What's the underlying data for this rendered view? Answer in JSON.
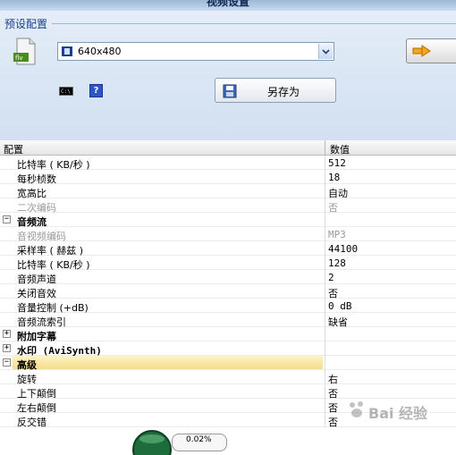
{
  "window": {
    "title": "视频设置"
  },
  "preset": {
    "section_label": "预设配置",
    "selected": "640x480",
    "save_as_label": "另存为",
    "help_glyph": "?",
    "cmd_glyph": "C:\\"
  },
  "grid": {
    "headers": {
      "name": "配置",
      "value": "数值"
    },
    "rows": [
      {
        "kind": "item",
        "name": "比特率 ( KB/秒 )",
        "value": "512"
      },
      {
        "kind": "item",
        "name": "每秒桢数",
        "value": "18"
      },
      {
        "kind": "item",
        "name": "宽高比",
        "value": "自动"
      },
      {
        "kind": "item",
        "name": "二次编码",
        "value": "否",
        "disabled": true
      },
      {
        "kind": "category",
        "name": "音频流",
        "toggle": "−"
      },
      {
        "kind": "item",
        "name": "音视频编码",
        "value": "MP3",
        "disabled": true
      },
      {
        "kind": "item",
        "name": "采样率 ( 赫兹 )",
        "value": "44100"
      },
      {
        "kind": "item",
        "name": "比特率 ( KB/秒 )",
        "value": "128"
      },
      {
        "kind": "item",
        "name": "音频声道",
        "value": "2"
      },
      {
        "kind": "item",
        "name": "关闭音效",
        "value": "否"
      },
      {
        "kind": "item",
        "name": "音量控制 (+dB)",
        "value": "0 dB"
      },
      {
        "kind": "item",
        "name": "音频流索引",
        "value": "缺省"
      },
      {
        "kind": "category",
        "name": "附加字幕",
        "toggle": "+"
      },
      {
        "kind": "category",
        "name": "水印 (AviSynth)",
        "toggle": "+"
      },
      {
        "kind": "category",
        "name": "高级",
        "toggle": "−",
        "selected": true
      },
      {
        "kind": "item",
        "name": "旋转",
        "value": "右"
      },
      {
        "kind": "item",
        "name": "上下颠倒",
        "value": "否"
      },
      {
        "kind": "item",
        "name": "左右颠倒",
        "value": "否"
      },
      {
        "kind": "item",
        "name": "反交错",
        "value": "否"
      }
    ]
  },
  "progress": {
    "text": "0.02%"
  },
  "watermark": {
    "text": "Bai 经验"
  },
  "colors": {
    "panel": "#dce7f5",
    "section_label": "#1b3f8b",
    "selected_row": "#f7dc8a"
  }
}
